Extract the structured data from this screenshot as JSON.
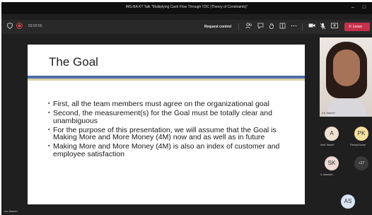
{
  "window": {
    "title": "IMS-BA KT Talk \"Multiplying Cash Flow Through TOC (Theory of Constraints)\"",
    "minimize": "–",
    "maximize": "□"
  },
  "toolbar": {
    "timer": "59:02:55",
    "request_control": "Request control",
    "leave": "Leave"
  },
  "slide": {
    "title": "The Goal",
    "bullets": [
      "First, all the team members must agree on the organizational goal",
      "Second, the measurement(s) for the Goal must be totally clear and unambiguous",
      "For the purpose of this presentation, we will assume that the Goal is Making More and More Money (4M) now and as well as in future",
      "Making More and More Money (4M) is also an index of customer and employee satisfaction"
    ]
  },
  "presenter": {
    "name": "Ira Jhaveri",
    "video_name": "Ira Jhaveri"
  },
  "participants": [
    {
      "initials": "A",
      "label": "Amit Jhaveri",
      "color": "#f1e1d3"
    },
    {
      "initials": "PK",
      "label": "Pankaj Kumar",
      "color": "#f6df9c"
    },
    {
      "initials": "SK",
      "label": "S Jaiswant...",
      "color": "#eed9d5"
    },
    {
      "initials": "+27",
      "label": ""
    },
    {
      "initials": "AS",
      "label": "",
      "color": "#d6e4f3"
    }
  ],
  "colors": {
    "leave": "#c4314b",
    "slide_rule": "#4d6ea8"
  }
}
